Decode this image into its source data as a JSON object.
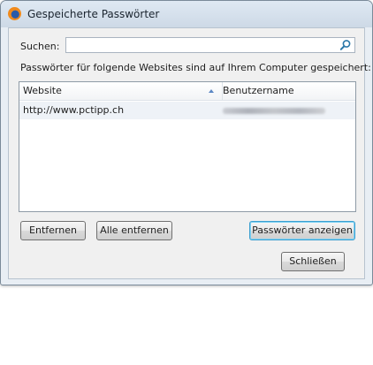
{
  "window": {
    "title": "Gespeicherte Passwörter",
    "app_icon": "firefox-icon"
  },
  "search": {
    "label": "Suchen:",
    "value": "",
    "placeholder": "",
    "icon": "magnifier-icon"
  },
  "info_text": "Passwörter für folgende Websites sind auf Ihrem Computer gespeichert:",
  "table": {
    "columns": [
      "Website",
      "Benutzername"
    ],
    "sort_column": "Website",
    "sort_direction": "ascending",
    "rows": [
      {
        "website": "http://www.pctipp.ch",
        "username_blurred": true
      }
    ]
  },
  "buttons": {
    "remove": "Entfernen",
    "remove_all": "Alle entfernen",
    "show_passwords": "Passwörter anzeigen",
    "close": "Schließen"
  },
  "colors": {
    "focus_border": "#3c9fd0",
    "sort_arrow": "#5b87c4",
    "selected_row": "#eef2f7"
  }
}
